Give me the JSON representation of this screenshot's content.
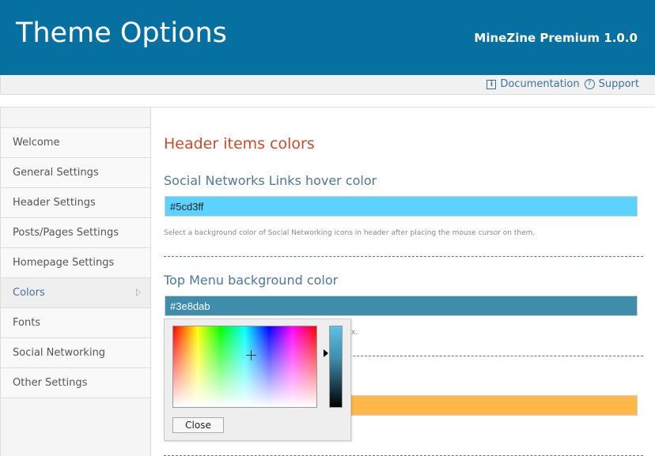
{
  "header": {
    "title": "Theme Options",
    "version": "MineZine Premium 1.0.0"
  },
  "topbar": {
    "documentation": "Documentation",
    "support": "Support"
  },
  "sidebar": {
    "items": [
      {
        "label": "Welcome"
      },
      {
        "label": "General Settings"
      },
      {
        "label": "Header Settings"
      },
      {
        "label": "Posts/Pages Settings"
      },
      {
        "label": "Homepage Settings"
      },
      {
        "label": "Colors"
      },
      {
        "label": "Fonts"
      },
      {
        "label": "Social Networking"
      },
      {
        "label": "Other Settings"
      }
    ],
    "active": "Colors"
  },
  "content": {
    "section_title": "Header items colors",
    "fields": [
      {
        "label": "Social Networks Links hover color",
        "value": "#5cd3ff",
        "description": "Select a background color of Social Networking icons in header after placing the mouse cursor on them."
      },
      {
        "label": "Top Menu background color",
        "value": "#3e8dab",
        "description": "x."
      },
      {
        "label": "",
        "value": "",
        "color": "#ffb847"
      }
    ]
  },
  "colorpicker": {
    "close_label": "Close"
  },
  "colors": {
    "header_bg": "#0670a0",
    "section_title": "#d1482a",
    "label": "#4a78a0",
    "field1": "#5cd3ff",
    "field2": "#3e8dab",
    "field3": "#ffb847"
  }
}
